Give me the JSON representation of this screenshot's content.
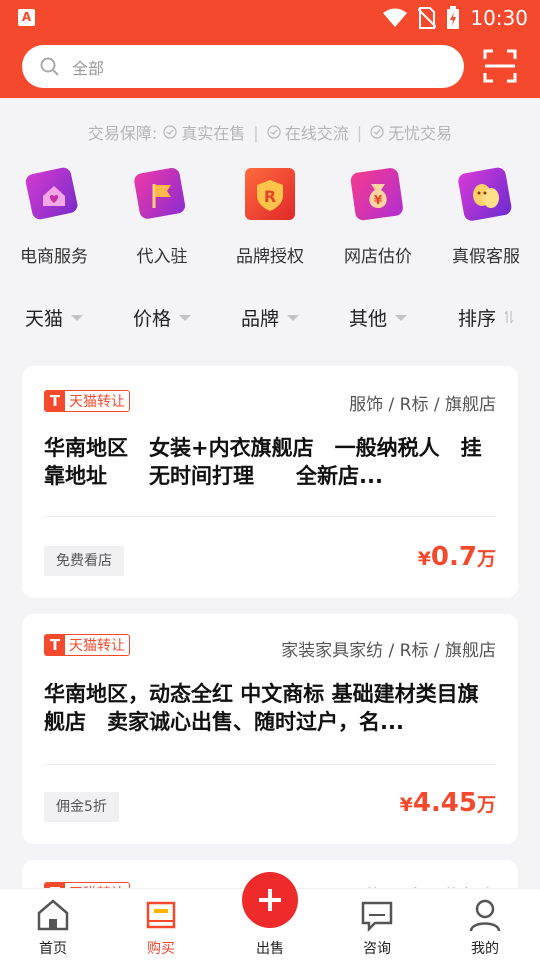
{
  "status_bar": {
    "app_icon": "A",
    "time": "10:30",
    "icons": [
      "wifi-icon",
      "no-sim-icon",
      "battery-charging-icon"
    ]
  },
  "search": {
    "placeholder": "全部",
    "icon": "search-icon",
    "scan_icon": "scan-icon"
  },
  "assurance": {
    "label": "交易保障:",
    "items": [
      "真实在售",
      "在线交流",
      "无忧交易"
    ]
  },
  "services": [
    {
      "label": "电商服务",
      "icon": "house-heart-icon"
    },
    {
      "label": "代入驻",
      "icon": "flag-icon"
    },
    {
      "label": "品牌授权",
      "icon": "r-shield-icon"
    },
    {
      "label": "网店估价",
      "icon": "money-bag-icon"
    },
    {
      "label": "真假客服",
      "icon": "masks-icon"
    }
  ],
  "filters": [
    {
      "label": "天猫"
    },
    {
      "label": "价格"
    },
    {
      "label": "品牌"
    },
    {
      "label": "其他"
    },
    {
      "label": "排序"
    }
  ],
  "listings": [
    {
      "badge": "天猫转让",
      "category": "服饰 / R标 / 旗舰店",
      "title": "华南地区　女装+内衣旗舰店　一般纳税人　挂靠地址　　无时间打理　　全新店...",
      "tag": "免费看店",
      "price_symbol": "¥",
      "price": "0.7",
      "price_unit": "万"
    },
    {
      "badge": "天猫转让",
      "category": "家装家具家纺 / R标 / 旗舰店",
      "title": "华南地区，动态全红 中文商标 基础建材类目旗舰店　卖家诚心出售、随时过户，名...",
      "tag": "佣金5折",
      "price_symbol": "¥",
      "price": "4.45",
      "price_unit": "万"
    },
    {
      "badge": "天猫转让",
      "category": "服饰 / R标 / 旗舰店"
    }
  ],
  "bottom_nav": [
    {
      "label": "首页",
      "icon": "home-icon"
    },
    {
      "label": "购买",
      "icon": "buy-icon",
      "active": true
    },
    {
      "label": "出售",
      "icon": "plus-icon"
    },
    {
      "label": "咨询",
      "icon": "chat-icon"
    },
    {
      "label": "我的",
      "icon": "profile-icon"
    }
  ],
  "colors": {
    "accent": "#f5492e",
    "sell_button": "#ee2a2a"
  }
}
